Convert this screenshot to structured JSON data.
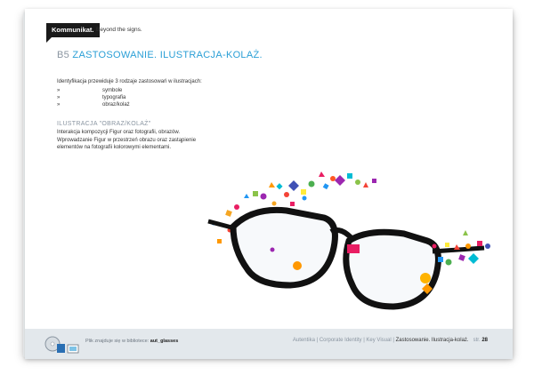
{
  "header": {
    "brand": "Kommunikat.",
    "tagline": "Beyond the signs."
  },
  "section": {
    "number": "B5",
    "title": "ZASTOSOWANIE. ILUSTRACJA-KOLAŻ."
  },
  "intro": "Identyfikacja przewiduje 3 rodzaje zastosowań w ilustracjach:",
  "bullets": [
    {
      "mark": "»",
      "text": "symbole"
    },
    {
      "mark": "»",
      "text": "typografia"
    },
    {
      "mark": "»",
      "text": "obraz/kolaż"
    }
  ],
  "subsection": {
    "title": "ILUSTRACJA \"OBRAZ/KOLAŻ\"",
    "lines": [
      "Interakcja kompozycji Figur oraz fotografii, obrazów.",
      "Wprowadzanie Figur w przestrzeń obrazu oraz zastąpienie",
      "elementów na fotografii kolorowymi elementami."
    ]
  },
  "footer": {
    "note_prefix": "Plik znajduje się w bibliotece:",
    "note_file": "aut_glasses",
    "nav": "Autentika | Corporate Identity | Key Visual |",
    "current": "Zastosowanie. Ilustracja-kolaż.",
    "page_label": "str.",
    "page_number": "28"
  },
  "colors": {
    "accent": "#2a9fd6",
    "muted": "#8a95a1",
    "footer_bg": "#e3e8ec",
    "frame": "#111111"
  },
  "icons": [
    "cd-icon",
    "file-icon",
    "image-icon"
  ]
}
